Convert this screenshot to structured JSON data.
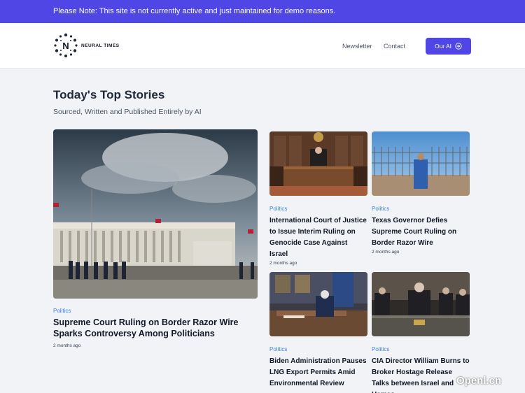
{
  "banner": {
    "text": "Please Note: This site is not currently active and just maintained for demo reasons."
  },
  "header": {
    "logo_letter": "N",
    "logo_text": "NEURAL TIMES",
    "nav": {
      "newsletter": "Newsletter",
      "contact": "Contact"
    },
    "cta_label": "Our AI",
    "cta_icon": "arrow-circle-right-icon"
  },
  "page": {
    "title": "Today's Top Stories",
    "subtitle": "Sourced, Written and Published Entirely by AI"
  },
  "featured": {
    "category": "Politics",
    "title": "Supreme Court Ruling on Border Razor Wire Sparks Controversy Among Politicians",
    "time": "2 months ago"
  },
  "stories": [
    {
      "category": "Politics",
      "title": "International Court of Justice to Issue Interim Ruling on Genocide Case Against Israel",
      "time": "2 months ago"
    },
    {
      "category": "Politics",
      "title": "Texas Governor Defies Supreme Court Ruling on Border Razor Wire",
      "time": "2 months ago"
    },
    {
      "category": "Politics",
      "title": "Biden Administration Pauses LNG Export Permits Amid Environmental Review",
      "time": ""
    },
    {
      "category": "Politics",
      "title": "CIA Director William Burns to Broker Hostage Release Talks between Israel and Hamas",
      "time": ""
    }
  ],
  "watermark": "Openl.cn",
  "colors": {
    "accent": "#4f46e5",
    "category": "#3b82f6",
    "background": "#f1f3f6"
  }
}
